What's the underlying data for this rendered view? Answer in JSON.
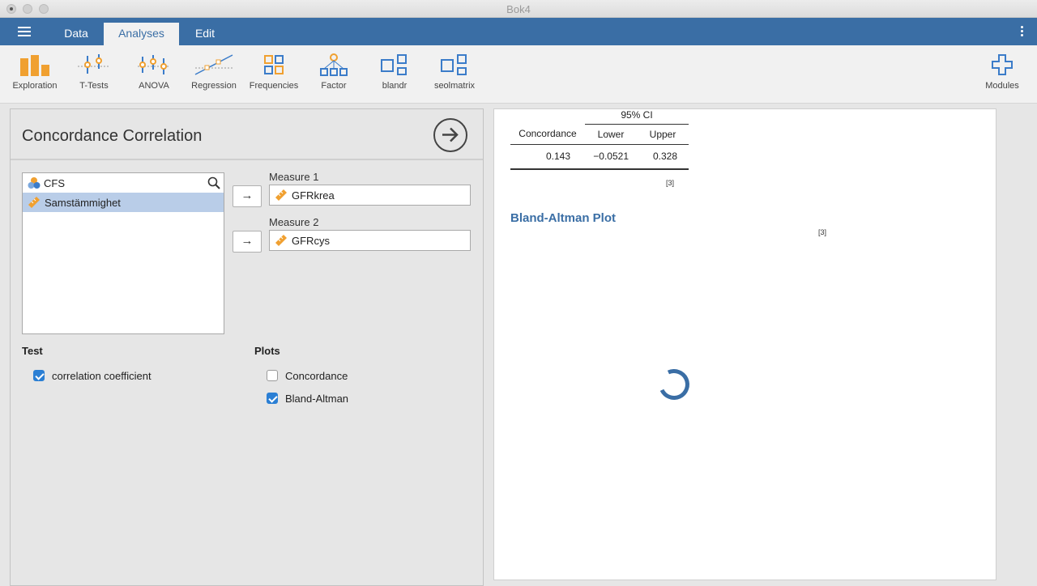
{
  "window": {
    "title": "Bok4"
  },
  "menu": {
    "tabs": [
      "Data",
      "Analyses",
      "Edit"
    ],
    "active": "Analyses"
  },
  "ribbon": {
    "items": [
      "Exploration",
      "T-Tests",
      "ANOVA",
      "Regression",
      "Frequencies",
      "Factor",
      "blandr",
      "seolmatrix"
    ],
    "modules": "Modules"
  },
  "panel": {
    "title": "Concordance Correlation",
    "variables": {
      "search_item": "CFS",
      "items": [
        "Samstämmighet"
      ]
    },
    "measure1": {
      "label": "Measure 1",
      "value": "GFRkrea"
    },
    "measure2": {
      "label": "Measure 2",
      "value": "GFRcys"
    },
    "test": {
      "heading": "Test",
      "options": [
        {
          "label": "correlation coefficient",
          "checked": true
        }
      ]
    },
    "plots": {
      "heading": "Plots",
      "options": [
        {
          "label": "Concordance",
          "checked": false
        },
        {
          "label": "Bland-Altman",
          "checked": true
        }
      ]
    }
  },
  "results": {
    "table": {
      "ci_header": "95% CI",
      "col_concordance": "Concordance",
      "col_lower": "Lower",
      "col_upper": "Upper",
      "row": {
        "concordance": "0.143",
        "lower": "−0.0521",
        "upper": "0.328"
      },
      "note": "[3]"
    },
    "plot_title": "Bland-Altman Plot",
    "plot_note": "[3]"
  },
  "colors": {
    "accent": "#3a6ea5",
    "selection": "#b9cde8",
    "checkbox": "#2b7fd4",
    "icon_orange": "#f0a030",
    "icon_blue": "#3b7cc9"
  }
}
